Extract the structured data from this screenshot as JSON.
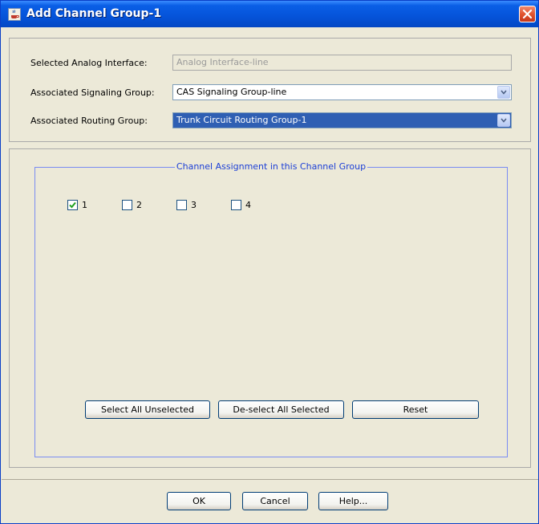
{
  "window": {
    "title": "Add Channel Group-1"
  },
  "fields": {
    "analog_interface_label": "Selected Analog Interface:",
    "analog_interface_value": "Analog Interface-line",
    "signaling_group_label": "Associated Signaling Group:",
    "signaling_group_value": "CAS Signaling Group-line",
    "routing_group_label": "Associated Routing Group:",
    "routing_group_value": "Trunk Circuit Routing Group-1"
  },
  "channels": {
    "group_title": "Channel Assignment in this Channel Group",
    "items": [
      {
        "label": "1",
        "checked": true
      },
      {
        "label": "2",
        "checked": false
      },
      {
        "label": "3",
        "checked": false
      },
      {
        "label": "4",
        "checked": false
      }
    ],
    "select_all_label": "Select All Unselected",
    "deselect_all_label": "De-select All Selected",
    "reset_label": "Reset"
  },
  "footer": {
    "ok_label": "OK",
    "cancel_label": "Cancel",
    "help_label": "Help..."
  },
  "icons": {
    "title": "java-coffee-icon",
    "close": "close-icon",
    "dropdown": "chevron-down-icon",
    "check": "checkmark-icon"
  },
  "colors": {
    "titlebar": "#0553d9",
    "close_button": "#e2552f",
    "selection": "#2f5fb3",
    "group_border": "#7a8cf2",
    "group_title": "#1c3fd6",
    "checkmark": "#21a121"
  }
}
